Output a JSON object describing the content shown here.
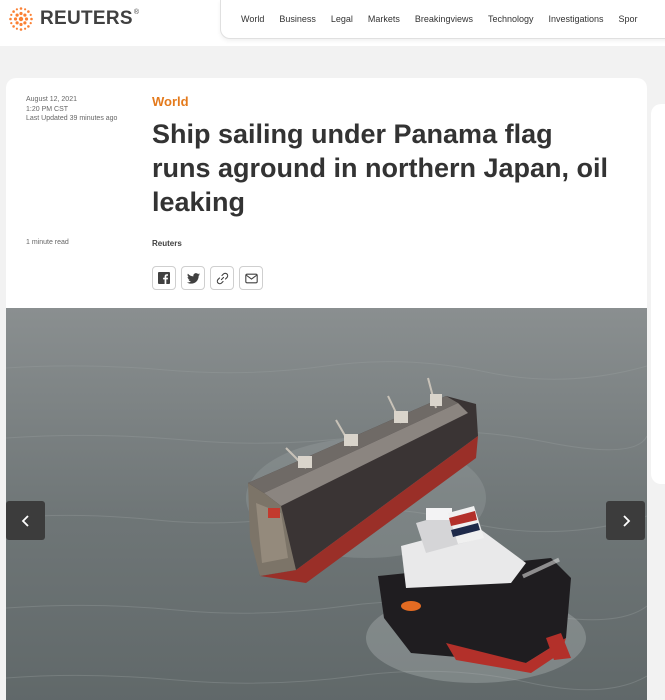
{
  "brand": {
    "name": "REUTERS",
    "mark": "®"
  },
  "nav": {
    "items": [
      "World",
      "Business",
      "Legal",
      "Markets",
      "Breakingviews",
      "Technology",
      "Investigations",
      "Spor"
    ]
  },
  "article": {
    "date": "August 12, 2021",
    "time": "1:20 PM CST",
    "updated": "Last Updated 39 minutes ago",
    "read_time": "1 minute read",
    "section": "World",
    "headline": "Ship sailing under Panama flag runs aground in northern Japan, oil leaking",
    "byline": "Reuters"
  },
  "share": {
    "icons": [
      "facebook-icon",
      "twitter-icon",
      "link-icon",
      "email-icon"
    ]
  },
  "colors": {
    "section": "#e47a1c",
    "brand_orange": "#fb8033"
  }
}
